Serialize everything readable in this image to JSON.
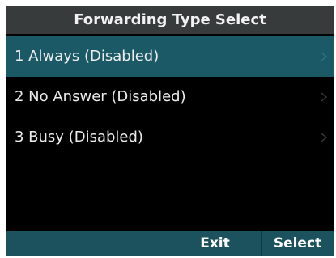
{
  "header": {
    "title": "Forwarding Type Select"
  },
  "menu": {
    "selected_index": 0,
    "items": [
      {
        "label": "1 Always (Disabled)",
        "icon": "chevron-right-icon"
      },
      {
        "label": "2 No Answer (Disabled)",
        "icon": "chevron-right-icon"
      },
      {
        "label": "3 Busy (Disabled)",
        "icon": "chevron-right-icon"
      }
    ]
  },
  "softkeys": {
    "key1": "",
    "key2": "",
    "key3": "Exit",
    "key4": "Select"
  },
  "colors": {
    "title_bar": "#373b3c",
    "selected_row": "#1a5965",
    "softkey_bar": "#1c525e",
    "background": "#000000"
  }
}
